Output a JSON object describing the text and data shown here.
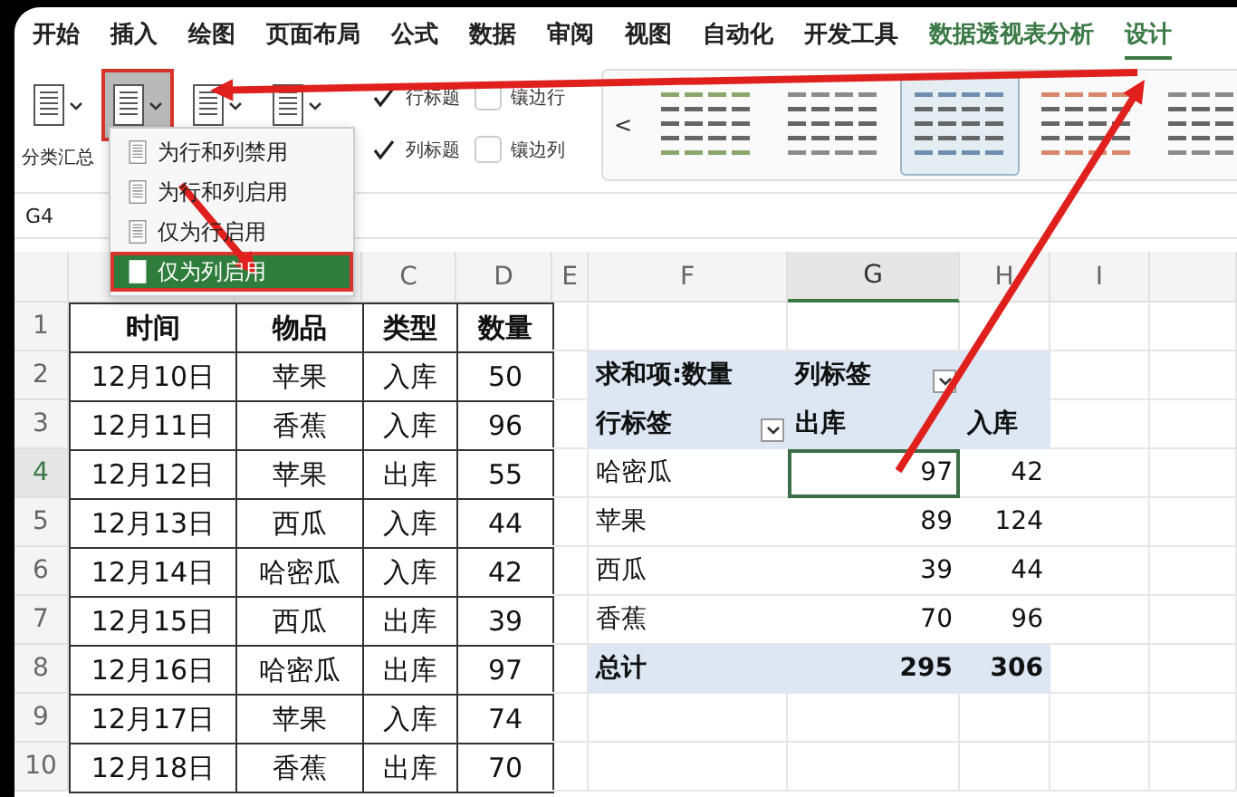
{
  "tabs": [
    {
      "label": "开始",
      "kind": "normal",
      "selected": false
    },
    {
      "label": "插入",
      "kind": "normal",
      "selected": false
    },
    {
      "label": "绘图",
      "kind": "normal",
      "selected": false
    },
    {
      "label": "页面布局",
      "kind": "normal",
      "selected": false
    },
    {
      "label": "公式",
      "kind": "normal",
      "selected": false
    },
    {
      "label": "数据",
      "kind": "normal",
      "selected": false
    },
    {
      "label": "审阅",
      "kind": "normal",
      "selected": false
    },
    {
      "label": "视图",
      "kind": "normal",
      "selected": false
    },
    {
      "label": "自动化",
      "kind": "normal",
      "selected": false
    },
    {
      "label": "开发工具",
      "kind": "normal",
      "selected": false
    },
    {
      "label": "数据透视表分析",
      "kind": "contextual",
      "selected": false
    },
    {
      "label": "设计",
      "kind": "contextual",
      "selected": true
    }
  ],
  "ribbon": {
    "subtotal_label": "分类汇总",
    "layout_buttons": [
      {
        "selected": false
      },
      {
        "selected": true
      },
      {
        "selected": false
      },
      {
        "selected": false
      }
    ],
    "options": [
      {
        "label": "行标题",
        "checked": true
      },
      {
        "label": "镶边行",
        "checked": false
      },
      {
        "label": "列标题",
        "checked": true
      },
      {
        "label": "镶边列",
        "checked": false
      }
    ],
    "gallery_prev": "<",
    "styles": [
      {
        "color": "#8aa86a",
        "selected": false
      },
      {
        "color": "#8c8c8c",
        "selected": false
      },
      {
        "color": "#6f8fb0",
        "selected": true
      },
      {
        "color": "#d9876a",
        "selected": false
      },
      {
        "color": "#8c8c8c",
        "selected": false
      }
    ]
  },
  "menu": [
    {
      "label": "为行和列禁用",
      "selected": false
    },
    {
      "label": "为行和列启用",
      "selected": false
    },
    {
      "label": "仅为行启用",
      "selected": false
    },
    {
      "label": "仅为列启用",
      "selected": true
    }
  ],
  "name_box": "G4",
  "columns": [
    {
      "label": "C",
      "selected": false
    },
    {
      "label": "D",
      "selected": false
    },
    {
      "label": "E",
      "selected": false
    },
    {
      "label": "F",
      "selected": false
    },
    {
      "label": "G",
      "selected": true
    },
    {
      "label": "H",
      "selected": false
    },
    {
      "label": "I",
      "selected": false
    }
  ],
  "rows": [
    {
      "label": "1",
      "selected": false
    },
    {
      "label": "2",
      "selected": false
    },
    {
      "label": "3",
      "selected": false
    },
    {
      "label": "4",
      "selected": true
    },
    {
      "label": "5",
      "selected": false
    },
    {
      "label": "6",
      "selected": false
    },
    {
      "label": "7",
      "selected": false
    },
    {
      "label": "8",
      "selected": false
    },
    {
      "label": "9",
      "selected": false
    },
    {
      "label": "10",
      "selected": false
    }
  ],
  "table": [
    [
      "时间",
      "物品",
      "类型",
      "数量"
    ],
    [
      "12月10日",
      "苹果",
      "入库",
      "50"
    ],
    [
      "12月11日",
      "香蕉",
      "入库",
      "96"
    ],
    [
      "12月12日",
      "苹果",
      "出库",
      "55"
    ],
    [
      "12月13日",
      "西瓜",
      "入库",
      "44"
    ],
    [
      "12月14日",
      "哈密瓜",
      "入库",
      "42"
    ],
    [
      "12月15日",
      "西瓜",
      "出库",
      "39"
    ],
    [
      "12月16日",
      "哈密瓜",
      "出库",
      "97"
    ],
    [
      "12月17日",
      "苹果",
      "入库",
      "74"
    ],
    [
      "12月18日",
      "香蕉",
      "出库",
      "70"
    ]
  ],
  "pivot": {
    "header": "求和项:数量",
    "col_label": "列标签",
    "row_label": "行标签",
    "columns": [
      "出库",
      "入库"
    ],
    "rows": [
      {
        "label": "哈密瓜",
        "values": [
          {
            "text": "97",
            "selected": true
          },
          {
            "text": "42",
            "selected": false
          }
        ]
      },
      {
        "label": "苹果",
        "values": [
          {
            "text": "89",
            "selected": false
          },
          {
            "text": "124",
            "selected": false
          }
        ]
      },
      {
        "label": "西瓜",
        "values": [
          {
            "text": "39",
            "selected": false
          },
          {
            "text": "44",
            "selected": false
          }
        ]
      },
      {
        "label": "香蕉",
        "values": [
          {
            "text": "70",
            "selected": false
          },
          {
            "text": "96",
            "selected": false
          }
        ]
      }
    ],
    "total": {
      "label": "总计",
      "values": [
        "295",
        "306"
      ]
    }
  }
}
